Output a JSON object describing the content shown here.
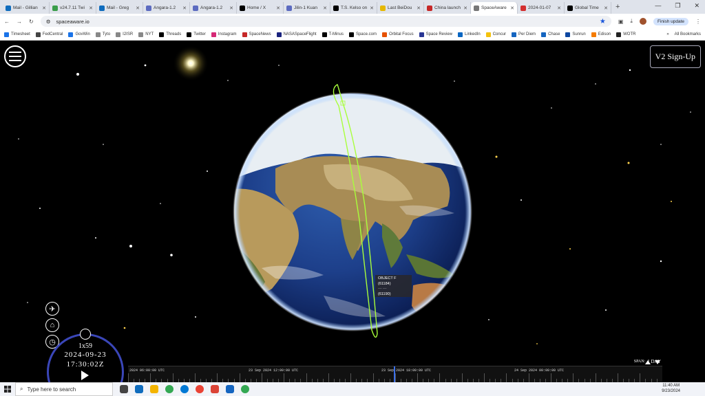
{
  "browser": {
    "tabs": [
      {
        "label": "Mail - Gillian",
        "color": "#0f6cbd"
      },
      {
        "label": "v24.7.11 Twi",
        "color": "#3a9d4a"
      },
      {
        "label": "Mail - Greg",
        "color": "#0f6cbd"
      },
      {
        "label": "Angara-1.2",
        "color": "#5c6bc0"
      },
      {
        "label": "Angara-1.2",
        "color": "#5c6bc0"
      },
      {
        "label": "Home / X",
        "color": "#000000"
      },
      {
        "label": "Jilin-1 Kuan",
        "color": "#5c6bc0"
      },
      {
        "label": "T.S. Kelso on",
        "color": "#000000"
      },
      {
        "label": "Last BeiDou",
        "color": "#e6b800"
      },
      {
        "label": "China launch",
        "color": "#c62828"
      },
      {
        "label": "SpaceAware",
        "color": "#777777",
        "active": true
      },
      {
        "label": "2024-01-07",
        "color": "#d32f2f"
      },
      {
        "label": "Global Time",
        "color": "#000000"
      }
    ],
    "new_tab": "+",
    "window_controls": [
      "—",
      "❐",
      "✕"
    ],
    "url": "spaceaware.io",
    "finish_update": "Finish update",
    "bookmarks": [
      {
        "label": "Timesheet",
        "color": "#1a73e8"
      },
      {
        "label": "FedCentral",
        "color": "#444444"
      },
      {
        "label": "GovWin",
        "color": "#1a73e8"
      },
      {
        "label": "Tyto",
        "color": "#888888"
      },
      {
        "label": "I2ISR",
        "color": "#888888"
      },
      {
        "label": "NYT",
        "color": "#888888"
      },
      {
        "label": "Threads",
        "color": "#000000"
      },
      {
        "label": "Twitter",
        "color": "#000000"
      },
      {
        "label": "Instagram",
        "color": "#d62976"
      },
      {
        "label": "SpaceNews",
        "color": "#c62828"
      },
      {
        "label": "NASASpaceFlight",
        "color": "#1a237e"
      },
      {
        "label": "T-Minus",
        "color": "#000000"
      },
      {
        "label": "Space.com",
        "color": "#000000"
      },
      {
        "label": "Orbital Focus",
        "color": "#e65100"
      },
      {
        "label": "Space Review",
        "color": "#283593"
      },
      {
        "label": "LinkedIn",
        "color": "#0a66c2"
      },
      {
        "label": "Concur",
        "color": "#f4c20d"
      },
      {
        "label": "Per Diem",
        "color": "#1565c0"
      },
      {
        "label": "Chase",
        "color": "#1565c0"
      },
      {
        "label": "Sunrun",
        "color": "#0d47a1"
      },
      {
        "label": "Edison",
        "color": "#f57c00"
      },
      {
        "label": "WOTR",
        "color": "#222222"
      }
    ],
    "more": "»",
    "all_bookmarks": "All Bookmarks"
  },
  "app": {
    "signup": "V2 Sign-Up",
    "clock": {
      "speed": "1x59",
      "date": "2024-09-23",
      "time": "17:30:02Z"
    },
    "span_label": "SPAN:",
    "span_value": "1 DAY",
    "timeline_labels": [
      "2024 06:00:00 UTC",
      "23 Sep 2024 12:00:00 UTC",
      "23 Sep 2024 18:00:00 UTC",
      "24 Sep 2024 00:00:00 UTC"
    ],
    "tooltip": [
      "OBJECT F",
      "(61184)",
      "(61190)"
    ],
    "colors": {
      "orbit": "#a8ff3a",
      "dial": "#3a46b8",
      "timeline_cursor": "#3b6fe8"
    }
  },
  "taskbar": {
    "search_placeholder": "Type here to search",
    "time": "11:40 AM",
    "date": "9/23/2024"
  }
}
